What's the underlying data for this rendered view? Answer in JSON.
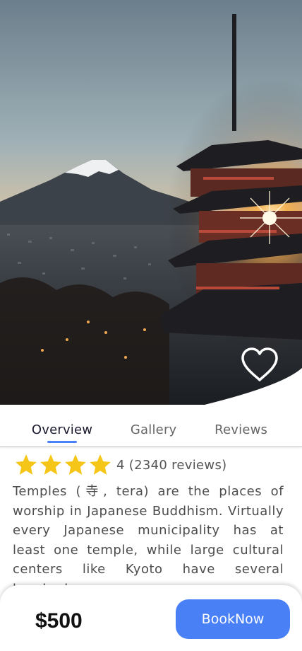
{
  "hero": {
    "image_icon": "pagoda-mount-fuji-photo",
    "favorite_icon": "heart-outline-icon"
  },
  "tabs": [
    {
      "label": "Overview",
      "active": true
    },
    {
      "label": "Gallery",
      "active": false
    },
    {
      "label": "Reviews",
      "active": false
    }
  ],
  "rating": {
    "stars": 4,
    "text": "4 (2340 reviews)"
  },
  "description": "Temples (寺, tera) are the places of worship in Japanese Buddhism. Virtually every Japanese municipality has at least one temple, while large cultural centers like Kyoto have several hundred.",
  "footer": {
    "price": "$500",
    "book_label": "BookNow"
  },
  "colors": {
    "accent": "#4a80f5",
    "star": "#f5c518"
  }
}
